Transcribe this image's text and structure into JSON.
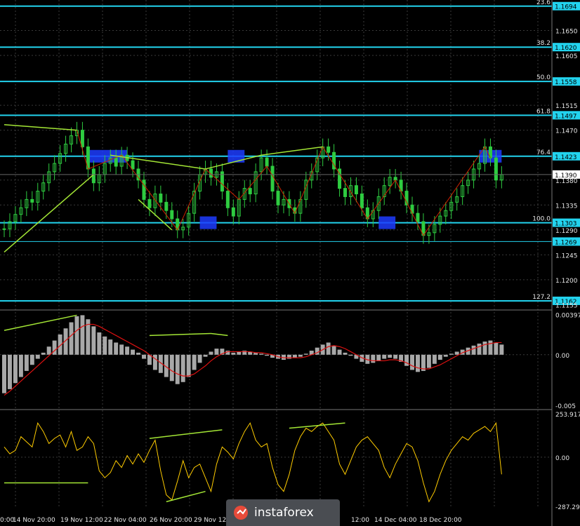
{
  "colors": {
    "background": "#000000",
    "grid": "#3a3a3a",
    "candle": "#2ecc40",
    "fib_line": "#22d3ee",
    "fib_label": "#e6e6e6",
    "zigzag": "#cc2200",
    "trendline": "#a3e635",
    "zone": "#1d3cff",
    "histogram": "#a8a8a8",
    "signal": "#dd1111",
    "cci": "#ffcc00",
    "axis_text": "#e6e6e6"
  },
  "chart_data": {
    "type": "line",
    "price_axis_ticks": [
      "1.1650",
      "1.1605",
      "1.1515",
      "1.1470",
      "1.1380",
      "1.1335",
      "1.1290",
      "1.1245",
      "1.1200",
      "1.1155"
    ],
    "time_axis_ticks": [
      "0:00",
      "14 Nov 20:00",
      "19 Nov 12:00",
      "22 Nov 04:00",
      "26 Nov 20:00",
      "29 Nov 12:",
      "12:00",
      "14 Dec 04:00",
      "18 Dec 20:00"
    ],
    "fib_levels": [
      {
        "ratio": "23.6",
        "price": "1.1694",
        "value": 1.1694
      },
      {
        "ratio": "38.2",
        "price": "1.1620",
        "value": 1.162
      },
      {
        "ratio": "50.0",
        "price": "1.1558",
        "value": 1.1558
      },
      {
        "ratio": "61.8",
        "price": "1.1497",
        "value": 1.1497
      },
      {
        "ratio": "76.4",
        "price": "1.1423",
        "value": 1.1423
      },
      {
        "ratio": "100.0",
        "price": "1.1303",
        "value": 1.1303
      },
      {
        "ratio": "",
        "price": "1.1269",
        "value": 1.1269
      },
      {
        "ratio": "127.2",
        "price": "1.1162",
        "value": 1.1162
      }
    ],
    "current_price": "1.1390",
    "price_series": [
      1.1292,
      1.1305,
      1.1318,
      1.133,
      1.1345,
      1.134,
      1.136,
      1.1375,
      1.1395,
      1.141,
      1.1428,
      1.1445,
      1.146,
      1.147,
      1.144,
      1.14,
      1.1375,
      1.139,
      1.141,
      1.142,
      1.1405,
      1.1425,
      1.1415,
      1.14,
      1.138,
      1.1345,
      1.133,
      1.1355,
      1.134,
      1.1325,
      1.131,
      1.129,
      1.1295,
      1.132,
      1.136,
      1.139,
      1.14,
      1.1385,
      1.1395,
      1.136,
      1.133,
      1.1315,
      1.1345,
      1.1365,
      1.1355,
      1.1395,
      1.142,
      1.1405,
      1.136,
      1.1335,
      1.1345,
      1.133,
      1.132,
      1.1345,
      1.138,
      1.1395,
      1.142,
      1.144,
      1.143,
      1.14,
      1.1365,
      1.135,
      1.137,
      1.1355,
      1.133,
      1.131,
      1.1325,
      1.135,
      1.137,
      1.1385,
      1.138,
      1.136,
      1.1335,
      1.132,
      1.1305,
      1.128,
      1.1285,
      1.13,
      1.1315,
      1.1325,
      1.134,
      1.135,
      1.137,
      1.138,
      1.14,
      1.141,
      1.144,
      1.142,
      1.138,
      1.139
    ],
    "fib_zones": [
      {
        "from_index": 15,
        "to_index": 22,
        "price": 1.1423
      },
      {
        "from_index": 40,
        "to_index": 43,
        "price": 1.1423
      },
      {
        "from_index": 35,
        "to_index": 38,
        "price": 1.1303
      },
      {
        "from_index": 67,
        "to_index": 70,
        "price": 1.1303
      },
      {
        "from_index": 85,
        "to_index": 89,
        "price": 1.1423
      }
    ],
    "macd": {
      "axis_ticks": [
        "0.00397",
        "0.00",
        "-0.005"
      ],
      "ylim": [
        -0.005,
        0.004
      ],
      "histogram": [
        -0.0038,
        -0.0034,
        -0.0028,
        -0.0022,
        -0.0016,
        -0.001,
        -0.0004,
        0.0002,
        0.0008,
        0.0014,
        0.002,
        0.0026,
        0.0032,
        0.0038,
        0.0039,
        0.0035,
        0.0028,
        0.0022,
        0.0018,
        0.0015,
        0.0012,
        0.001,
        0.0008,
        0.0005,
        0.0002,
        -0.0004,
        -0.001,
        -0.0015,
        -0.0018,
        -0.0022,
        -0.0026,
        -0.0029,
        -0.0027,
        -0.0022,
        -0.0015,
        -0.0008,
        -0.0002,
        0.0003,
        0.0006,
        0.0006,
        0.0004,
        0.0002,
        0.0003,
        0.0004,
        0.0003,
        0.0002,
        0.0001,
        -0.0001,
        -0.0003,
        -0.0004,
        -0.0005,
        -0.0004,
        -0.0003,
        -0.0002,
        0.0001,
        0.0004,
        0.0007,
        0.001,
        0.0012,
        0.0009,
        0.0005,
        0.0002,
        -0.0001,
        -0.0004,
        -0.0007,
        -0.0009,
        -0.0008,
        -0.0006,
        -0.0004,
        -0.0003,
        -0.0004,
        -0.0007,
        -0.0011,
        -0.0015,
        -0.0017,
        -0.0016,
        -0.0013,
        -0.0009,
        -0.0005,
        -0.0002,
        0.0001,
        0.0003,
        0.0005,
        0.0007,
        0.0009,
        0.0011,
        0.0013,
        0.0014,
        0.0012,
        0.001
      ],
      "signal": [
        -0.004,
        -0.0036,
        -0.0031,
        -0.0026,
        -0.0021,
        -0.0016,
        -0.0011,
        -0.0006,
        -0.0001,
        0.0004,
        0.0009,
        0.0014,
        0.0019,
        0.0024,
        0.0028,
        0.003,
        0.003,
        0.0028,
        0.0025,
        0.0022,
        0.0019,
        0.0016,
        0.0013,
        0.001,
        0.0007,
        0.0004,
        0.0,
        -0.0004,
        -0.0008,
        -0.0012,
        -0.0016,
        -0.0019,
        -0.0021,
        -0.0021,
        -0.0019,
        -0.0015,
        -0.0011,
        -0.0006,
        -0.0002,
        0.0001,
        0.0003,
        0.0003,
        0.0003,
        0.0003,
        0.0003,
        0.0002,
        0.0002,
        0.0001,
        0.0,
        -0.0002,
        -0.0003,
        -0.0003,
        -0.0003,
        -0.0003,
        -0.0002,
        0.0,
        0.0002,
        0.0005,
        0.0008,
        0.0009,
        0.0008,
        0.0006,
        0.0003,
        0.0,
        -0.0003,
        -0.0005,
        -0.0006,
        -0.0006,
        -0.0006,
        -0.0005,
        -0.0005,
        -0.0006,
        -0.0008,
        -0.0011,
        -0.0013,
        -0.0014,
        -0.0014,
        -0.0012,
        -0.001,
        -0.0007,
        -0.0004,
        -0.0001,
        0.0002,
        0.0004,
        0.0006,
        0.0008,
        0.001,
        0.0011,
        0.0012,
        0.0012
      ]
    },
    "cci": {
      "axis_ticks": [
        "253.9171",
        "0.00",
        "-287.298"
      ],
      "ylim": [
        -287.298,
        253.9171
      ],
      "values": [
        60,
        20,
        40,
        120,
        90,
        60,
        200,
        150,
        80,
        110,
        130,
        60,
        150,
        40,
        60,
        120,
        80,
        -80,
        -120,
        -90,
        -20,
        -60,
        10,
        -40,
        20,
        -30,
        40,
        100,
        -80,
        -220,
        -250,
        -140,
        -20,
        -120,
        -60,
        -40,
        -120,
        -200,
        -40,
        60,
        30,
        -10,
        80,
        150,
        200,
        100,
        60,
        80,
        -60,
        -160,
        -200,
        -100,
        40,
        120,
        170,
        150,
        180,
        200,
        150,
        100,
        -40,
        -100,
        -20,
        60,
        100,
        120,
        80,
        40,
        -60,
        -120,
        -40,
        20,
        80,
        60,
        -20,
        -150,
        -260,
        -200,
        -100,
        -20,
        40,
        80,
        120,
        100,
        140,
        160,
        180,
        150,
        200,
        -100
      ],
      "trendlines": [
        {
          "from_index": 0,
          "from_value": -150,
          "to_index": 15,
          "to_value": -150
        },
        {
          "from_index": 26,
          "from_value": 110,
          "to_index": 39,
          "to_value": 160
        },
        {
          "from_index": 29,
          "from_value": -260,
          "to_index": 36,
          "to_value": -200
        },
        {
          "from_index": 51,
          "from_value": 170,
          "to_index": 61,
          "to_value": 200
        }
      ]
    }
  },
  "watermark": {
    "text": "instaforex"
  }
}
